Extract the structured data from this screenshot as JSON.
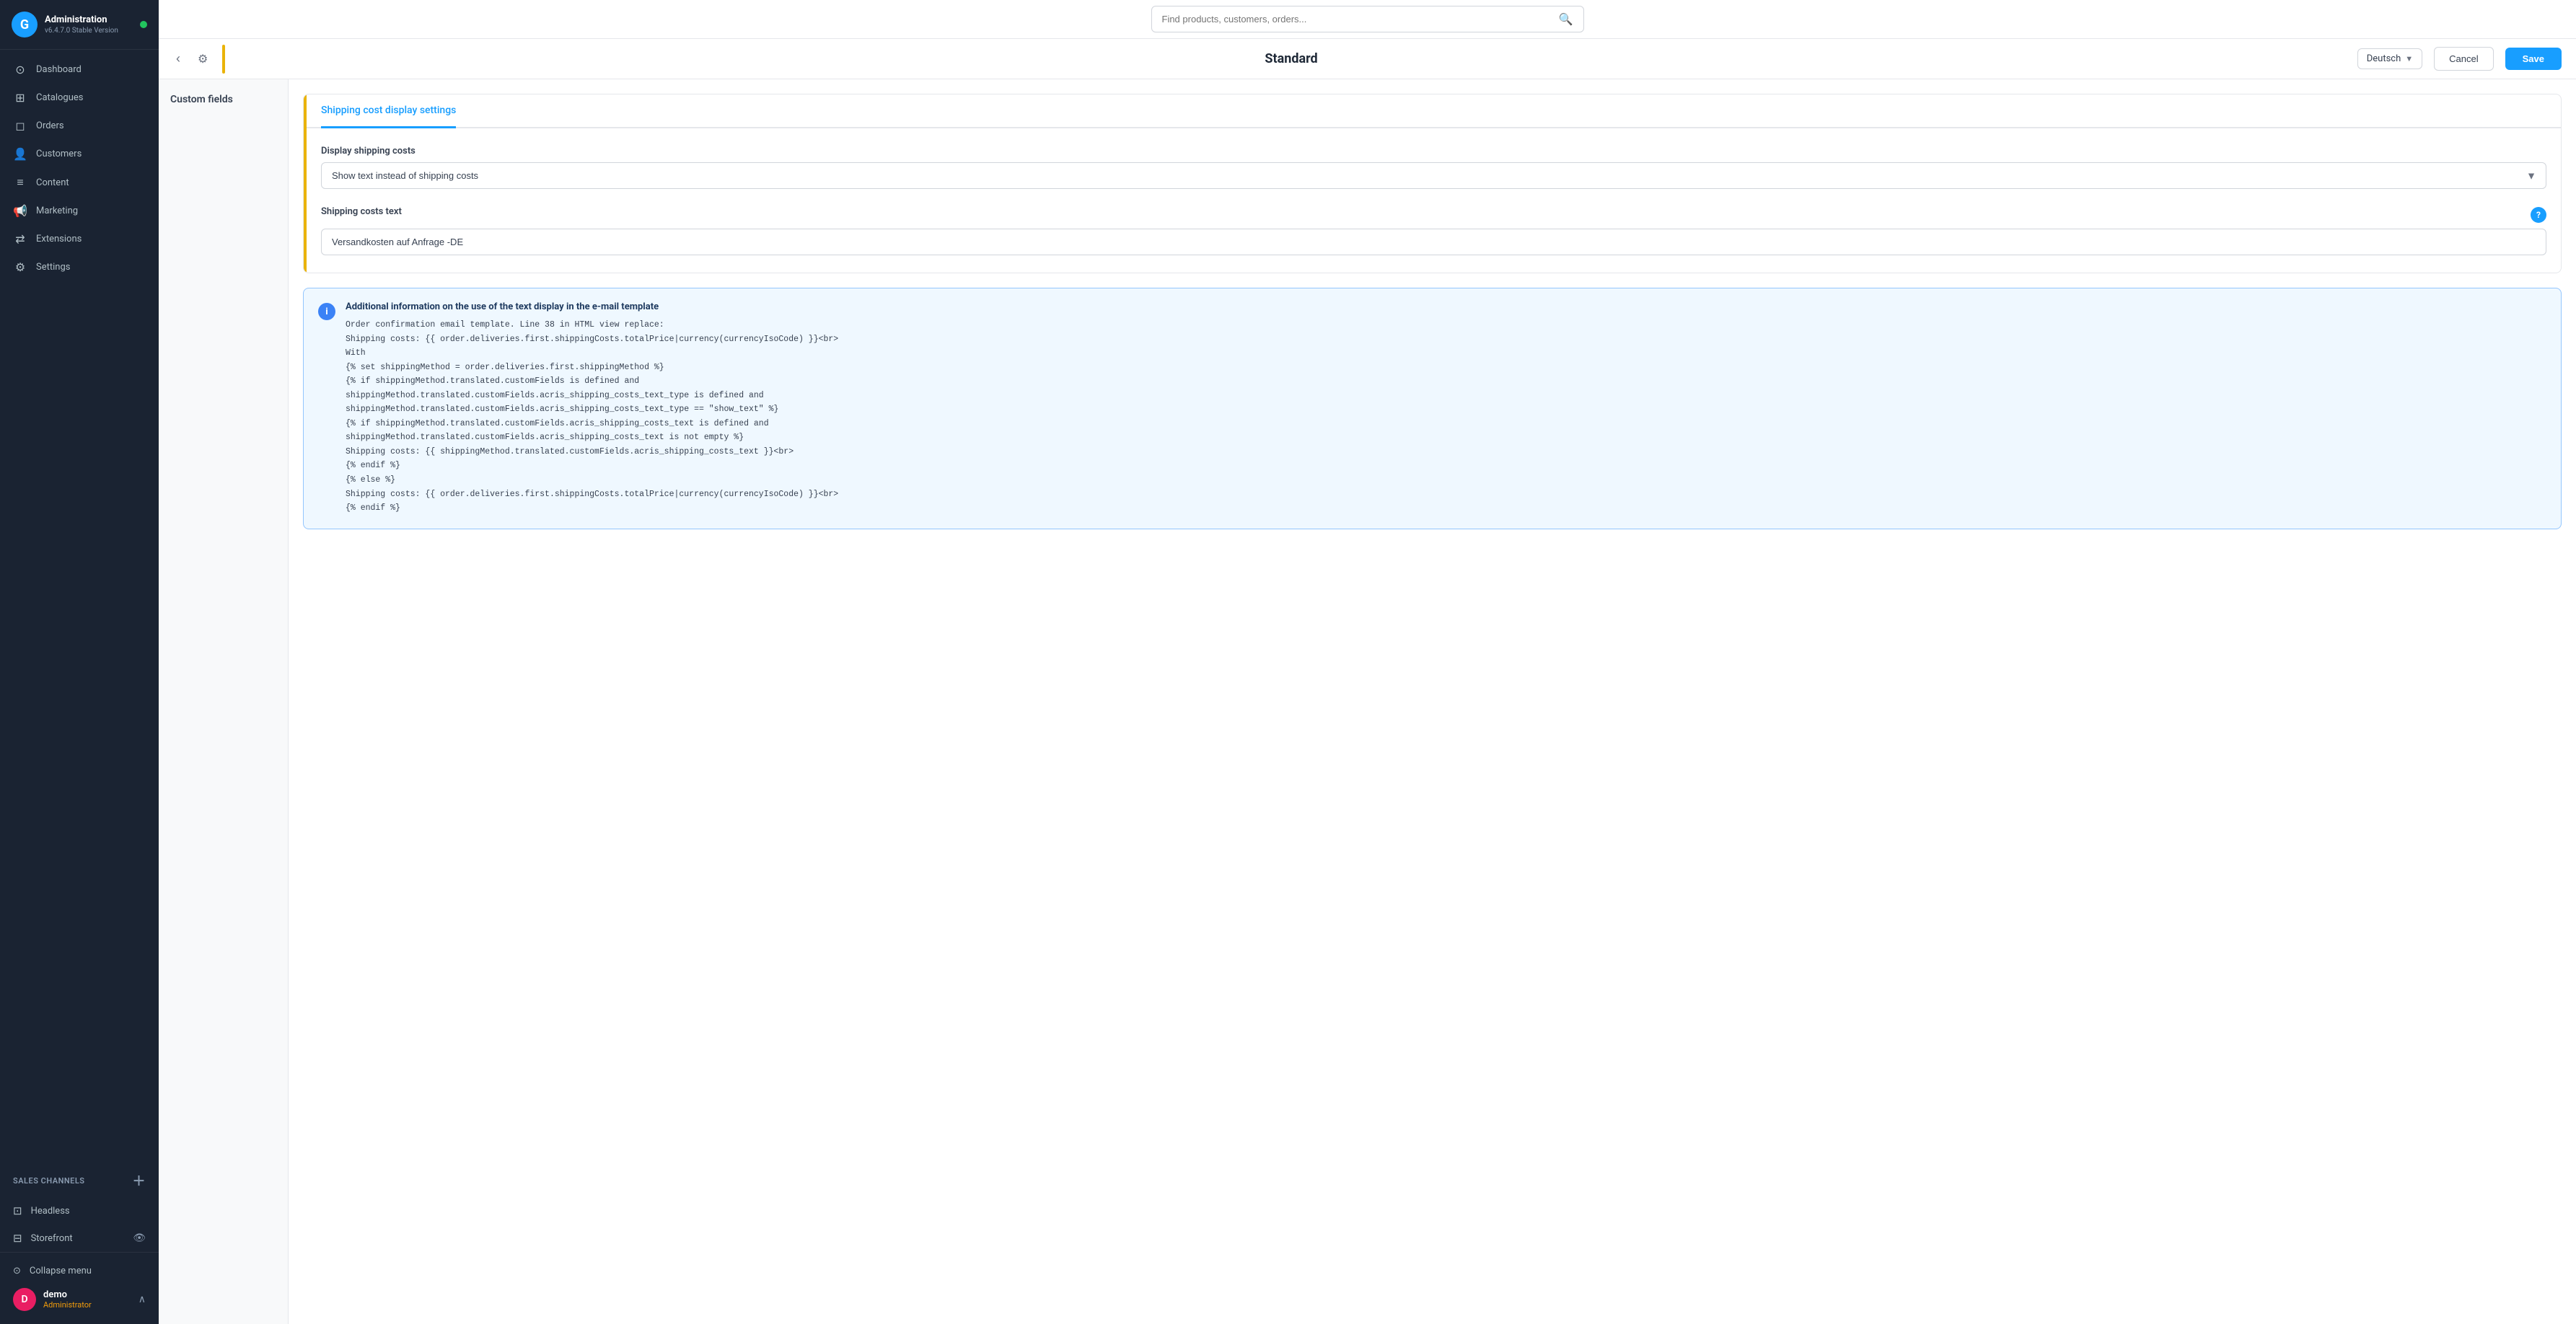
{
  "sidebar": {
    "app_name": "Administration",
    "app_version": "v6.4.7.0 Stable Version",
    "logo_letter": "G",
    "nav_items": [
      {
        "id": "dashboard",
        "label": "Dashboard",
        "icon": "⊙"
      },
      {
        "id": "catalogues",
        "label": "Catalogues",
        "icon": "⊞"
      },
      {
        "id": "orders",
        "label": "Orders",
        "icon": "◻"
      },
      {
        "id": "customers",
        "label": "Customers",
        "icon": "👤"
      },
      {
        "id": "content",
        "label": "Content",
        "icon": "≡"
      },
      {
        "id": "marketing",
        "label": "Marketing",
        "icon": "📢"
      },
      {
        "id": "extensions",
        "label": "Extensions",
        "icon": "⇄"
      },
      {
        "id": "settings",
        "label": "Settings",
        "icon": "⚙"
      }
    ],
    "sales_channels_label": "Sales Channels",
    "channels": [
      {
        "id": "headless",
        "label": "Headless",
        "icon": "⊡"
      },
      {
        "id": "storefront",
        "label": "Storefront",
        "icon": "⊟"
      }
    ],
    "collapse_menu_label": "Collapse menu",
    "user": {
      "initial": "D",
      "name": "demo",
      "role": "Administrator"
    }
  },
  "topbar": {
    "search_placeholder": "Find products, customers, orders..."
  },
  "page_header": {
    "title": "Standard",
    "language": "Deutsch",
    "cancel_label": "Cancel",
    "save_label": "Save"
  },
  "left_panel": {
    "title": "Custom fields"
  },
  "shipping_settings": {
    "tab_label": "Shipping cost display settings",
    "display_costs_label": "Display shipping costs",
    "display_costs_value": "Show text instead of shipping costs",
    "costs_text_label": "Shipping costs text",
    "costs_text_value": "Versandkosten auf Anfrage -DE"
  },
  "info_box": {
    "title": "Additional information on the use of the text display in the e-mail template",
    "lines": [
      "Order confirmation email template. Line 38 in HTML view replace:",
      "Shipping costs: {{ order.deliveries.first.shippingCosts.totalPrice|currency(currencyIsoCode) }}<br>",
      "With",
      "{% set shippingMethod = order.deliveries.first.shippingMethod %}",
      "{% if shippingMethod.translated.customFields is defined and",
      "shippingMethod.translated.customFields.acris_shipping_costs_text_type is defined and",
      "shippingMethod.translated.customFields.acris_shipping_costs_text_type == \"show_text\" %}",
      "{% if shippingMethod.translated.customFields.acris_shipping_costs_text is defined and",
      "shippingMethod.translated.customFields.acris_shipping_costs_text is not empty %}",
      "Shipping costs: {{ shippingMethod.translated.customFields.acris_shipping_costs_text }}<br>",
      "{% endif %}",
      "{% else %}",
      "Shipping costs: {{ order.deliveries.first.shippingCosts.totalPrice|currency(currencyIsoCode) }}<br>",
      "{% endif %}"
    ]
  }
}
